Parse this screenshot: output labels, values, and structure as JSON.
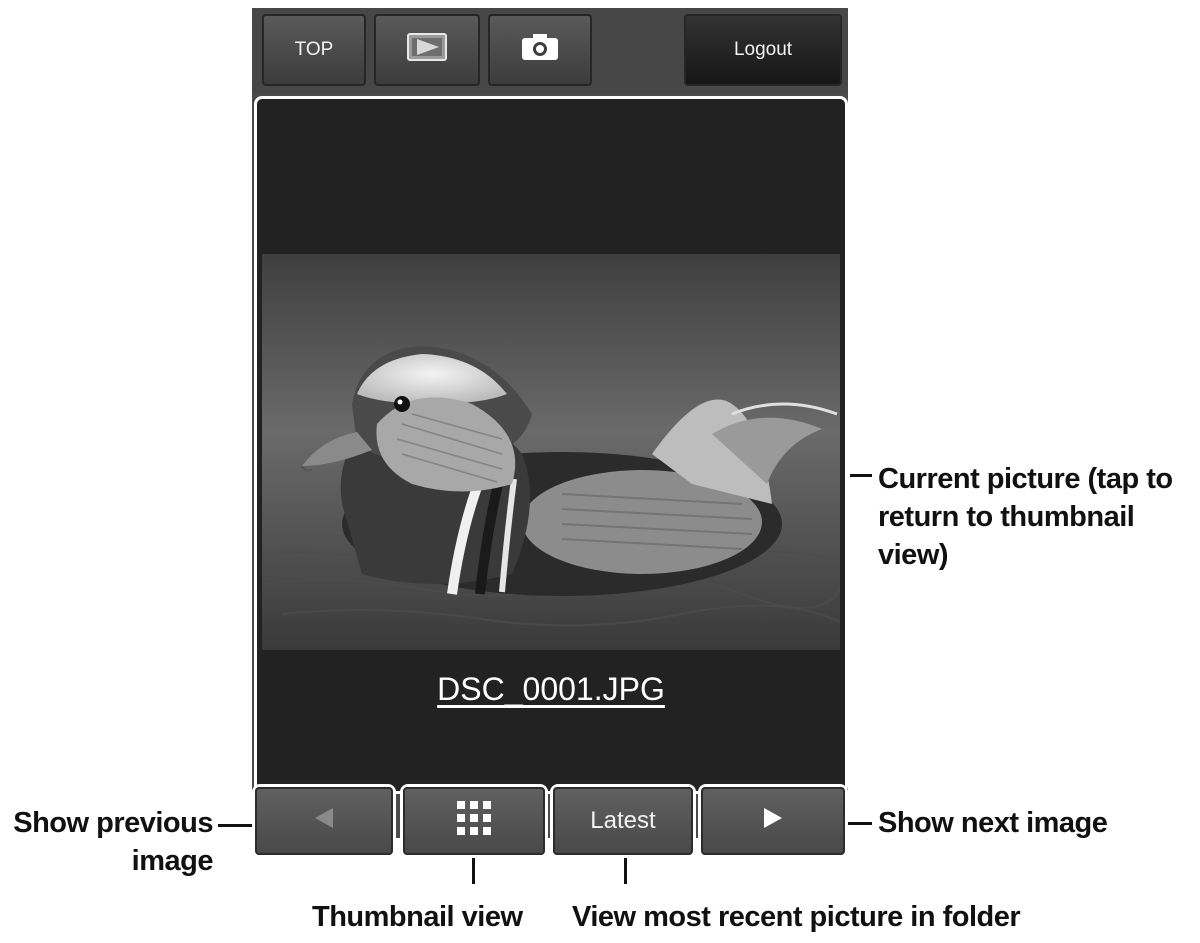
{
  "toolbar": {
    "top_label": "TOP",
    "playback_icon": "playback-icon",
    "camera_icon": "camera-icon",
    "logout_label": "Logout"
  },
  "viewer": {
    "filename": "DSC_0001.JPG",
    "image": "mandarin-duck-photo"
  },
  "bottom_nav": {
    "prev_icon": "left-triangle",
    "thumbnail_icon": "grid-icon",
    "latest_label": "Latest",
    "next_icon": "right-triangle"
  },
  "callouts": {
    "current_picture_line1": "Current picture (tap to",
    "current_picture_line2": "return to thumbnail",
    "current_picture_line3": "view)",
    "prev_line1": "Show previous",
    "prev_line2": "image",
    "next": "Show next image",
    "thumbnail": "Thumbnail view",
    "latest": "View most recent picture in folder"
  }
}
